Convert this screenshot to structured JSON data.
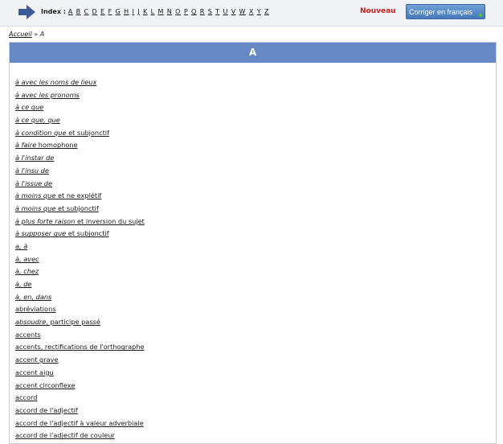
{
  "header": {
    "index_label": "Index :",
    "letters": [
      "A",
      "B",
      "C",
      "D",
      "E",
      "F",
      "G",
      "H",
      "I",
      "J",
      "K",
      "L",
      "M",
      "N",
      "O",
      "P",
      "Q",
      "R",
      "S",
      "T",
      "U",
      "V",
      "W",
      "X",
      "Y",
      "Z"
    ],
    "nouveau_label": "Nouveau",
    "corriger_label": "Corriger en français"
  },
  "breadcrumb": {
    "home": "Accueil",
    "separator": "»",
    "current": "A"
  },
  "panel": {
    "title": "A"
  },
  "entries": [
    {
      "italic": "à avec les noms de lieux",
      "rest": ""
    },
    {
      "italic": "à avec les pronoms",
      "rest": ""
    },
    {
      "italic": "à ce que",
      "rest": ""
    },
    {
      "italic": "à ce que, que",
      "rest": ""
    },
    {
      "italic": "à condition que",
      "rest": " et subjonctif"
    },
    {
      "italic": "à faire",
      "rest": " homophone"
    },
    {
      "italic": "à l'instar de",
      "rest": ""
    },
    {
      "italic": "à l'insu de",
      "rest": ""
    },
    {
      "italic": "à l'issue de",
      "rest": ""
    },
    {
      "italic": "à moins que",
      "rest": " et ne explétif"
    },
    {
      "italic": "à moins que",
      "rest": " et subjonctif"
    },
    {
      "italic": "à plus forte raison",
      "rest": " et inversion du sujet"
    },
    {
      "italic": "à supposer que",
      "rest": " et subjonctif"
    },
    {
      "italic": "a, à",
      "rest": ""
    },
    {
      "italic": "à, avec",
      "rest": ""
    },
    {
      "italic": "à, chez",
      "rest": ""
    },
    {
      "italic": "à, de",
      "rest": ""
    },
    {
      "italic": "à, en, dans",
      "rest": ""
    },
    {
      "italic": "",
      "rest": "abréviations"
    },
    {
      "italic": "absoudre",
      "rest": ", participe passé"
    },
    {
      "italic": "",
      "rest": "accents"
    },
    {
      "italic": "",
      "rest": "accents, rectifications de l'orthographe"
    },
    {
      "italic": "",
      "rest": "accent grave"
    },
    {
      "italic": "",
      "rest": "accent aigu"
    },
    {
      "italic": "",
      "rest": "accent circonflexe"
    },
    {
      "italic": "",
      "rest": "accord"
    },
    {
      "italic": "",
      "rest": "accord de l'adjectif"
    },
    {
      "italic": "",
      "rest": "accord de l'adjectif à valeur adverbiale"
    },
    {
      "italic": "",
      "rest": "accord de l'adjectif de couleur"
    }
  ]
}
